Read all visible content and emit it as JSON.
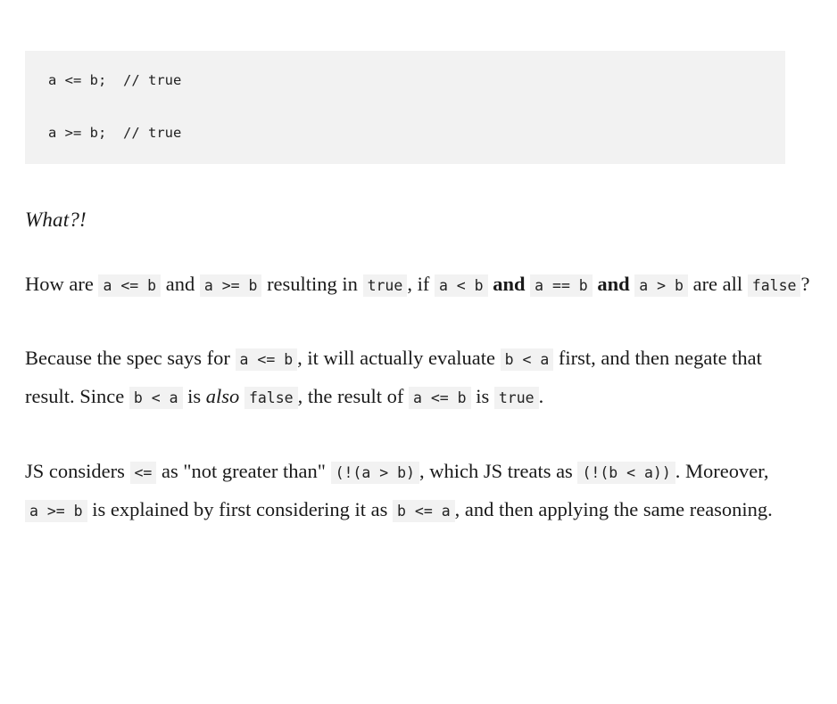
{
  "code_block": {
    "lines": [
      "a <= b;  // true",
      "a >= b;  // true"
    ],
    "background": "#f2f2f2"
  },
  "heading": {
    "text": "What?!"
  },
  "paragraphs": [
    {
      "id": "p1",
      "parts": [
        {
          "type": "text",
          "value": "How are "
        },
        {
          "type": "code",
          "value": "a <= b"
        },
        {
          "type": "text",
          "value": " and "
        },
        {
          "type": "code",
          "value": "a >= b"
        },
        {
          "type": "text",
          "value": " resulting in "
        },
        {
          "type": "code",
          "value": "true"
        },
        {
          "type": "text",
          "value": ", if "
        },
        {
          "type": "code",
          "value": "a < b"
        },
        {
          "type": "bold",
          "value": " and "
        },
        {
          "type": "code",
          "value": "a == b"
        },
        {
          "type": "bold",
          "value": " and "
        },
        {
          "type": "code",
          "value": "a > b"
        },
        {
          "type": "text",
          "value": " are all "
        },
        {
          "type": "code",
          "value": "false"
        },
        {
          "type": "text",
          "value": "?"
        }
      ]
    },
    {
      "id": "p2",
      "parts": [
        {
          "type": "text",
          "value": "Because the spec says for "
        },
        {
          "type": "code",
          "value": "a <= b"
        },
        {
          "type": "text",
          "value": ", it will actually evaluate "
        },
        {
          "type": "code",
          "value": "b < a"
        },
        {
          "type": "text",
          "value": " first, and then negate that result. Since "
        },
        {
          "type": "code",
          "value": "b < a"
        },
        {
          "type": "text",
          "value": " is "
        },
        {
          "type": "italic",
          "value": "also"
        },
        {
          "type": "text",
          "value": " "
        },
        {
          "type": "code",
          "value": "false"
        },
        {
          "type": "text",
          "value": ", the result of "
        },
        {
          "type": "code",
          "value": "a <= b"
        },
        {
          "type": "text",
          "value": " is "
        },
        {
          "type": "code",
          "value": "true"
        },
        {
          "type": "text",
          "value": "."
        }
      ]
    },
    {
      "id": "p3",
      "parts": [
        {
          "type": "text",
          "value": "JS considers "
        },
        {
          "type": "code",
          "value": "<="
        },
        {
          "type": "text",
          "value": " as \"not greater than\" "
        },
        {
          "type": "code",
          "value": "(!(a > b)"
        },
        {
          "type": "text",
          "value": ", which JS treats as "
        },
        {
          "type": "code",
          "value": "(!(b < a))"
        },
        {
          "type": "text",
          "value": ". Moreover, "
        },
        {
          "type": "code",
          "value": "a >= b"
        },
        {
          "type": "text",
          "value": " is explained by first considering it as "
        },
        {
          "type": "code",
          "value": "b <= a"
        },
        {
          "type": "text",
          "value": ", and then applying the same reasoning."
        }
      ]
    }
  ],
  "colors": {
    "page_background": "#ffffff",
    "code_background": "#f2f2f2",
    "text": "#1a1a1a",
    "code_text": "#222222"
  }
}
